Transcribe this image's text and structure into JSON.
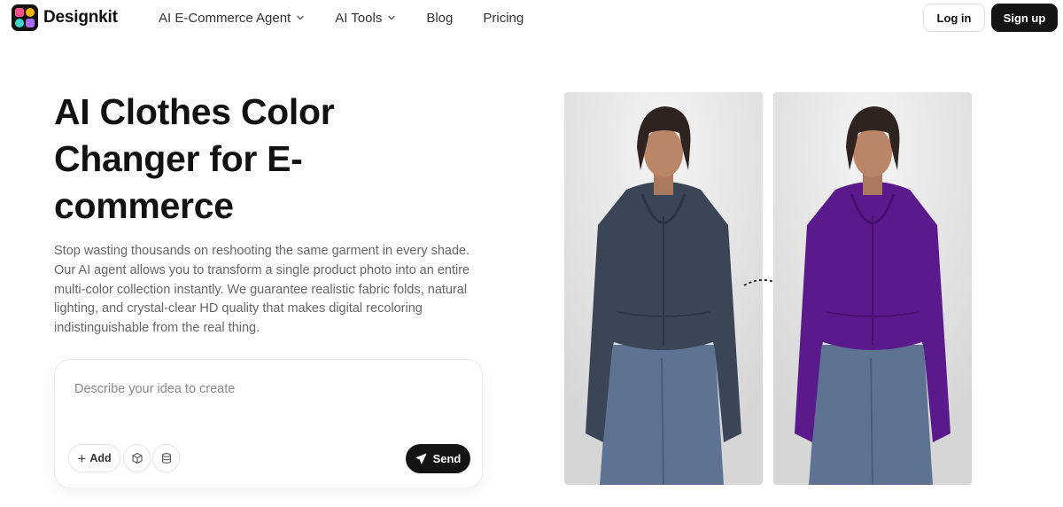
{
  "brand": {
    "name": "Designkit"
  },
  "nav": {
    "items": [
      {
        "label": "AI E-Commerce Agent",
        "has_dropdown": true
      },
      {
        "label": "AI Tools",
        "has_dropdown": true
      },
      {
        "label": "Blog",
        "has_dropdown": false
      },
      {
        "label": "Pricing",
        "has_dropdown": false
      }
    ]
  },
  "auth": {
    "login_label": "Log in",
    "signup_label": "Sign up"
  },
  "hero": {
    "title": "AI Clothes Color Changer for E-commerce",
    "description": "Stop wasting thousands on reshooting the same garment in every shade. Our AI agent allows you to transform a single product photo into an entire multi-color collection instantly. We guarantee realistic fabric folds, natural lighting, and crystal-clear HD quality that makes digital recoloring indistinguishable from the real thing."
  },
  "prompt": {
    "placeholder": "Describe your idea to create",
    "value": "",
    "add_label": "Add",
    "send_label": "Send",
    "tool_icons": [
      "cube-icon",
      "layers-icon"
    ]
  },
  "showcase": {
    "before_color": "#3a4556",
    "after_color": "#5b1a8c",
    "arrow_icon": "curved-arrow-icon"
  },
  "colors": {
    "primary_button": "#141414",
    "text_muted": "#666666"
  }
}
